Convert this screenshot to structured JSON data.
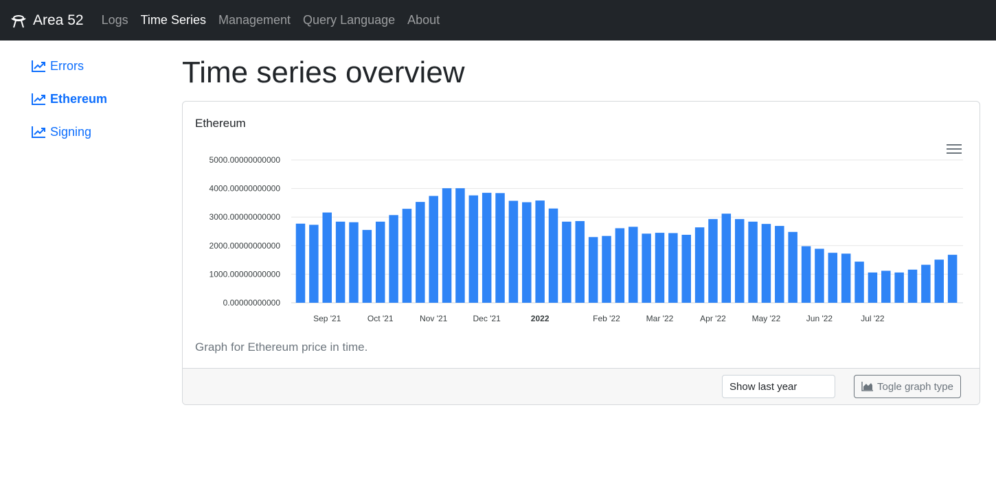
{
  "navbar": {
    "brand": "Area 52",
    "brand_icon": "ufo-icon",
    "links": [
      "Logs",
      "Time Series",
      "Management",
      "Query Language",
      "About"
    ],
    "active_link": "Time Series"
  },
  "sidebar": {
    "items": [
      {
        "label": "Errors",
        "icon": "chart-line-icon"
      },
      {
        "label": "Ethereum",
        "icon": "chart-line-icon"
      },
      {
        "label": "Signing",
        "icon": "chart-line-icon"
      }
    ],
    "active_item": "Ethereum"
  },
  "page": {
    "title": "Time series overview"
  },
  "card": {
    "title": "Ethereum",
    "description": "Graph for Ethereum price in time.",
    "range_select": "Show last year",
    "toggle_button": "Togle graph type"
  },
  "colors": {
    "bar": "#2f84f6",
    "navbar": "#212529",
    "link": "#0d6efd"
  },
  "chart_data": {
    "type": "bar",
    "title": "",
    "xlabel": "",
    "ylabel": "",
    "ylim": [
      0,
      5000
    ],
    "y_ticks": [
      "0.00000000000",
      "1000.00000000000",
      "2000.00000000000",
      "3000.00000000000",
      "4000.00000000000",
      "5000.00000000000"
    ],
    "x_ticks": [
      {
        "label": "Sep '21",
        "at_bar": 2
      },
      {
        "label": "Oct '21",
        "at_bar": 6
      },
      {
        "label": "Nov '21",
        "at_bar": 10
      },
      {
        "label": "Dec '21",
        "at_bar": 14
      },
      {
        "label": "2022",
        "at_bar": 18,
        "bold": true
      },
      {
        "label": "Feb '22",
        "at_bar": 23
      },
      {
        "label": "Mar '22",
        "at_bar": 27
      },
      {
        "label": "Apr '22",
        "at_bar": 31
      },
      {
        "label": "May '22",
        "at_bar": 35
      },
      {
        "label": "Jun '22",
        "at_bar": 39
      },
      {
        "label": "Jul '22",
        "at_bar": 43
      }
    ],
    "grid": true,
    "values": [
      2770,
      2730,
      3160,
      2840,
      2820,
      2550,
      2840,
      3070,
      3290,
      3530,
      3740,
      4010,
      4010,
      3760,
      3850,
      3840,
      3570,
      3520,
      3580,
      3300,
      2840,
      2860,
      2300,
      2340,
      2610,
      2660,
      2420,
      2450,
      2440,
      2380,
      2640,
      2930,
      3120,
      2930,
      2840,
      2760,
      2690,
      2480,
      1980,
      1890,
      1750,
      1720,
      1440,
      1060,
      1120,
      1060,
      1160,
      1330,
      1510,
      1680
    ]
  }
}
